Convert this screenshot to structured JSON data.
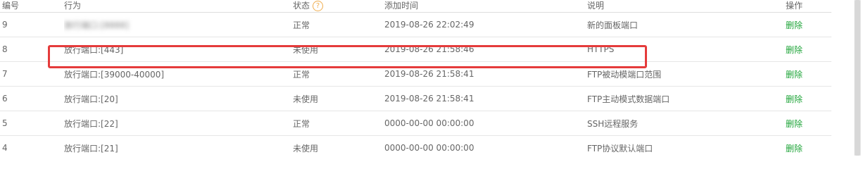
{
  "table": {
    "headers": {
      "id": "编号",
      "action": "行为",
      "status": "状态",
      "time": "添加时间",
      "desc": "说明",
      "op": "操作"
    },
    "help_glyph": "?",
    "rows": [
      {
        "id": "9",
        "action": "放行端口:[8888]",
        "status": "正常",
        "time": "2019-08-26 22:02:49",
        "desc": "新的面板端口",
        "op": "删除"
      },
      {
        "id": "8",
        "action": "放行端口:[443]",
        "status": "未使用",
        "time": "2019-08-26 21:58:46",
        "desc": "HTTPS",
        "op": "删除"
      },
      {
        "id": "7",
        "action": "放行端口:[39000-40000]",
        "status": "正常",
        "time": "2019-08-26 21:58:41",
        "desc": "FTP被动模端口范围",
        "op": "删除"
      },
      {
        "id": "6",
        "action": "放行端口:[20]",
        "status": "未使用",
        "time": "2019-08-26 21:58:41",
        "desc": "FTP主动模式数据端口",
        "op": "删除"
      },
      {
        "id": "5",
        "action": "放行端口:[22]",
        "status": "正常",
        "time": "0000-00-00 00:00:00",
        "desc": "SSH远程服务",
        "op": "删除"
      },
      {
        "id": "4",
        "action": "放行端口:[21]",
        "status": "未使用",
        "time": "0000-00-00 00:00:00",
        "desc": "FTP协议默认端口",
        "op": "删除"
      }
    ]
  },
  "colors": {
    "link": "#20a53a",
    "highlight": "#e53b3b",
    "help_icon": "#f0ad4e"
  }
}
